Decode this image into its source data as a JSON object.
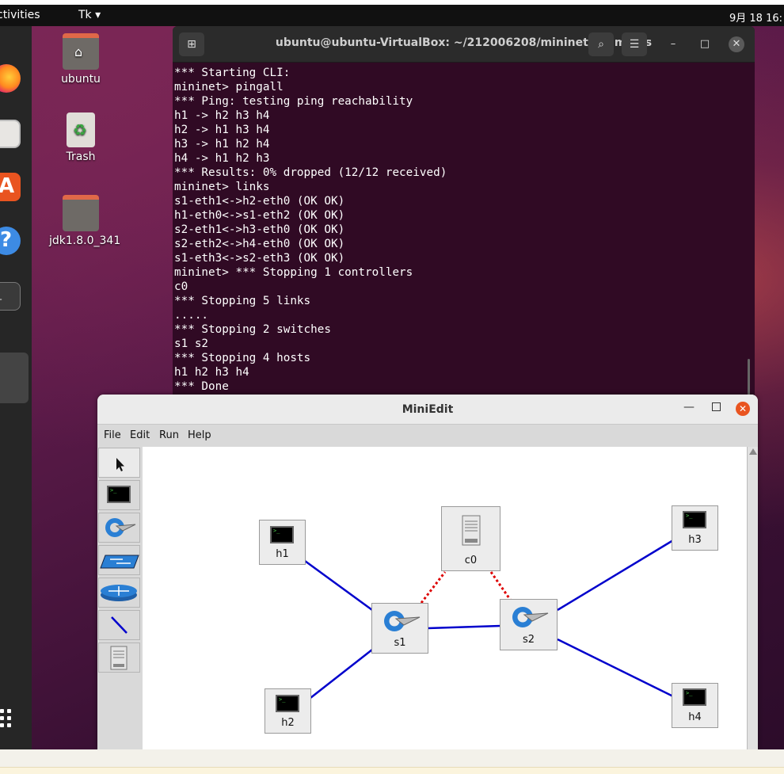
{
  "topbar": {
    "activities": "ctivities",
    "app_menu": "Tk ▾",
    "clock": "9月 18 16:"
  },
  "dock": {
    "items": [
      "firefox-icon",
      "files-icon",
      "software-icon",
      "help-icon",
      "terminal-icon"
    ],
    "software_glyph": "A",
    "help_glyph": "?",
    "terminal_glyph": "_"
  },
  "desktop": {
    "icons": [
      {
        "label": "ubuntu"
      },
      {
        "label": "Trash"
      },
      {
        "label": "jdk1.8.0_341"
      }
    ]
  },
  "terminal": {
    "title": "ubuntu@ubuntu-VirtualBox: ~/212006208/mininet/examples",
    "lines": [
      "*** Starting CLI:",
      "mininet> pingall",
      "*** Ping: testing ping reachability",
      "h1 -> h2 h3 h4",
      "h2 -> h1 h3 h4",
      "h3 -> h1 h2 h4",
      "h4 -> h1 h2 h3",
      "*** Results: 0% dropped (12/12 received)",
      "mininet> links",
      "s1-eth1<->h2-eth0 (OK OK)",
      "h1-eth0<->s1-eth2 (OK OK)",
      "s2-eth1<->h3-eth0 (OK OK)",
      "s2-eth2<->h4-eth0 (OK OK)",
      "s1-eth3<->s2-eth3 (OK OK)",
      "mininet> *** Stopping 1 controllers",
      "c0",
      "*** Stopping 5 links",
      ".....",
      "*** Stopping 2 switches",
      "s1 s2",
      "*** Stopping 4 hosts",
      "h1 h2 h3 h4",
      "*** Done"
    ]
  },
  "miniedit": {
    "title": "MiniEdit",
    "menu": {
      "file": "File",
      "edit": "Edit",
      "run": "Run",
      "help": "Help"
    },
    "tools": [
      "select-tool",
      "host-tool",
      "switch-tool",
      "legacy-switch-tool",
      "legacy-router-tool",
      "link-tool",
      "controller-tool"
    ],
    "nodes": {
      "h1": "h1",
      "h2": "h2",
      "h3": "h3",
      "h4": "h4",
      "s1": "s1",
      "s2": "s2",
      "c0": "c0"
    },
    "colors": {
      "link": "#0000cc",
      "control_link": "#dd0000",
      "close": "#e95420"
    }
  }
}
